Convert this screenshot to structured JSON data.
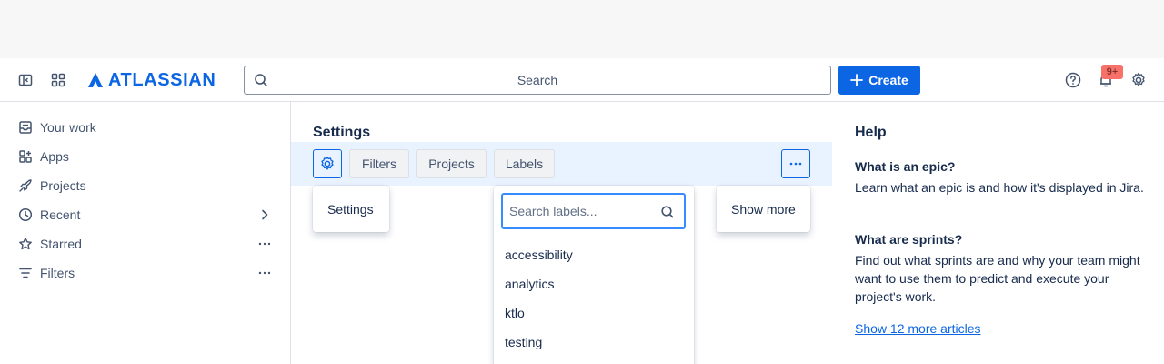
{
  "header": {
    "brand": "ATLASSIAN",
    "search_placeholder": "Search",
    "create_label": "Create",
    "notification_count": "9+"
  },
  "sidebar": {
    "items": [
      {
        "label": "Your work",
        "icon": "inbox-icon"
      },
      {
        "label": "Apps",
        "icon": "apps-icon"
      },
      {
        "label": "Projects",
        "icon": "rocket-icon"
      },
      {
        "label": "Recent",
        "icon": "clock-icon"
      },
      {
        "label": "Starred",
        "icon": "star-icon"
      },
      {
        "label": "Filters",
        "icon": "filter-icon"
      }
    ]
  },
  "main": {
    "title": "Settings",
    "toolbar": {
      "filters_label": "Filters",
      "projects_label": "Projects",
      "labels_label": "Labels"
    },
    "settings_popup_label": "Settings",
    "show_more_label": "Show more",
    "labels_dropdown": {
      "search_placeholder": "Search labels...",
      "options": [
        "accessibility",
        "analytics",
        "ktlo",
        "testing"
      ]
    }
  },
  "help": {
    "title": "Help",
    "articles": [
      {
        "question": "What is an epic?",
        "answer": "Learn what an epic is and how it's displayed in Jira."
      },
      {
        "question": "What are sprints?",
        "answer": "Find out what sprints are and why your team might want to use them to predict and execute your project's work."
      }
    ],
    "more_link": "Show 12 more articles"
  },
  "colors": {
    "brand_blue": "#0c66e4",
    "toolbar_bg": "#e9f2ff",
    "badge_bg": "#f87168"
  }
}
